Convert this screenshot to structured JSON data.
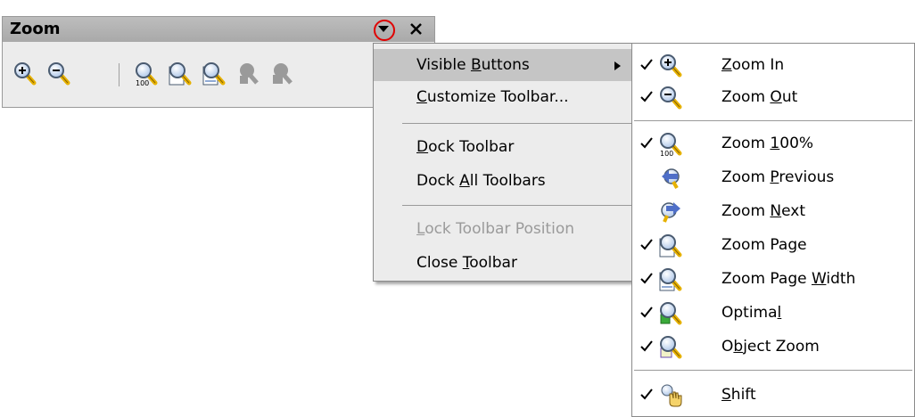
{
  "toolbar": {
    "title": "Zoom"
  },
  "context_menu": {
    "items": [
      {
        "pre": "Visible ",
        "u": "B",
        "post": "uttons",
        "has_submenu": true,
        "enabled": true,
        "highlighted": true
      },
      {
        "pre": "",
        "u": "C",
        "post": "ustomize Toolbar...",
        "has_submenu": false,
        "enabled": true
      },
      {
        "pre": "",
        "u": "D",
        "post": "ock Toolbar",
        "has_submenu": false,
        "enabled": true
      },
      {
        "pre": "Dock ",
        "u": "A",
        "post": "ll Toolbars",
        "has_submenu": false,
        "enabled": true
      },
      {
        "pre": "",
        "u": "L",
        "post": "ock Toolbar Position",
        "has_submenu": false,
        "enabled": false
      },
      {
        "pre": "Close ",
        "u": "T",
        "post": "oolbar",
        "has_submenu": false,
        "enabled": true
      }
    ]
  },
  "submenu": {
    "items": [
      {
        "pre": "",
        "u": "Z",
        "post": "oom In",
        "checked": true,
        "icon": "zoom-in-icon"
      },
      {
        "pre": "Zoom ",
        "u": "O",
        "post": "ut",
        "checked": true,
        "icon": "zoom-out-icon"
      },
      {
        "pre": "Zoom ",
        "u": "1",
        "post": "00%",
        "checked": true,
        "icon": "zoom-100-icon"
      },
      {
        "pre": "Zoom ",
        "u": "P",
        "post": "revious",
        "checked": false,
        "icon": "zoom-previous-icon"
      },
      {
        "pre": "Zoom ",
        "u": "N",
        "post": "ext",
        "checked": false,
        "icon": "zoom-next-icon"
      },
      {
        "pre": "Zoom Pa",
        "u": "g",
        "post": "e",
        "checked": true,
        "icon": "zoom-page-icon"
      },
      {
        "pre": "Zoom Page ",
        "u": "W",
        "post": "idth",
        "checked": true,
        "icon": "zoom-page-width-icon"
      },
      {
        "pre": "Optima",
        "u": "l",
        "post": "",
        "checked": true,
        "icon": "optimal-zoom-icon"
      },
      {
        "pre": "O",
        "u": "b",
        "post": "ject Zoom",
        "checked": true,
        "icon": "object-zoom-icon"
      },
      {
        "pre": "",
        "u": "S",
        "post": "hift",
        "checked": true,
        "icon": "shift-hand-icon"
      }
    ]
  },
  "colors": {
    "highlight_ring": "#e00000",
    "menu_bg": "#ececec",
    "menu_highlight": "#c5c5c5",
    "disabled_text": "#9a9a9a"
  }
}
